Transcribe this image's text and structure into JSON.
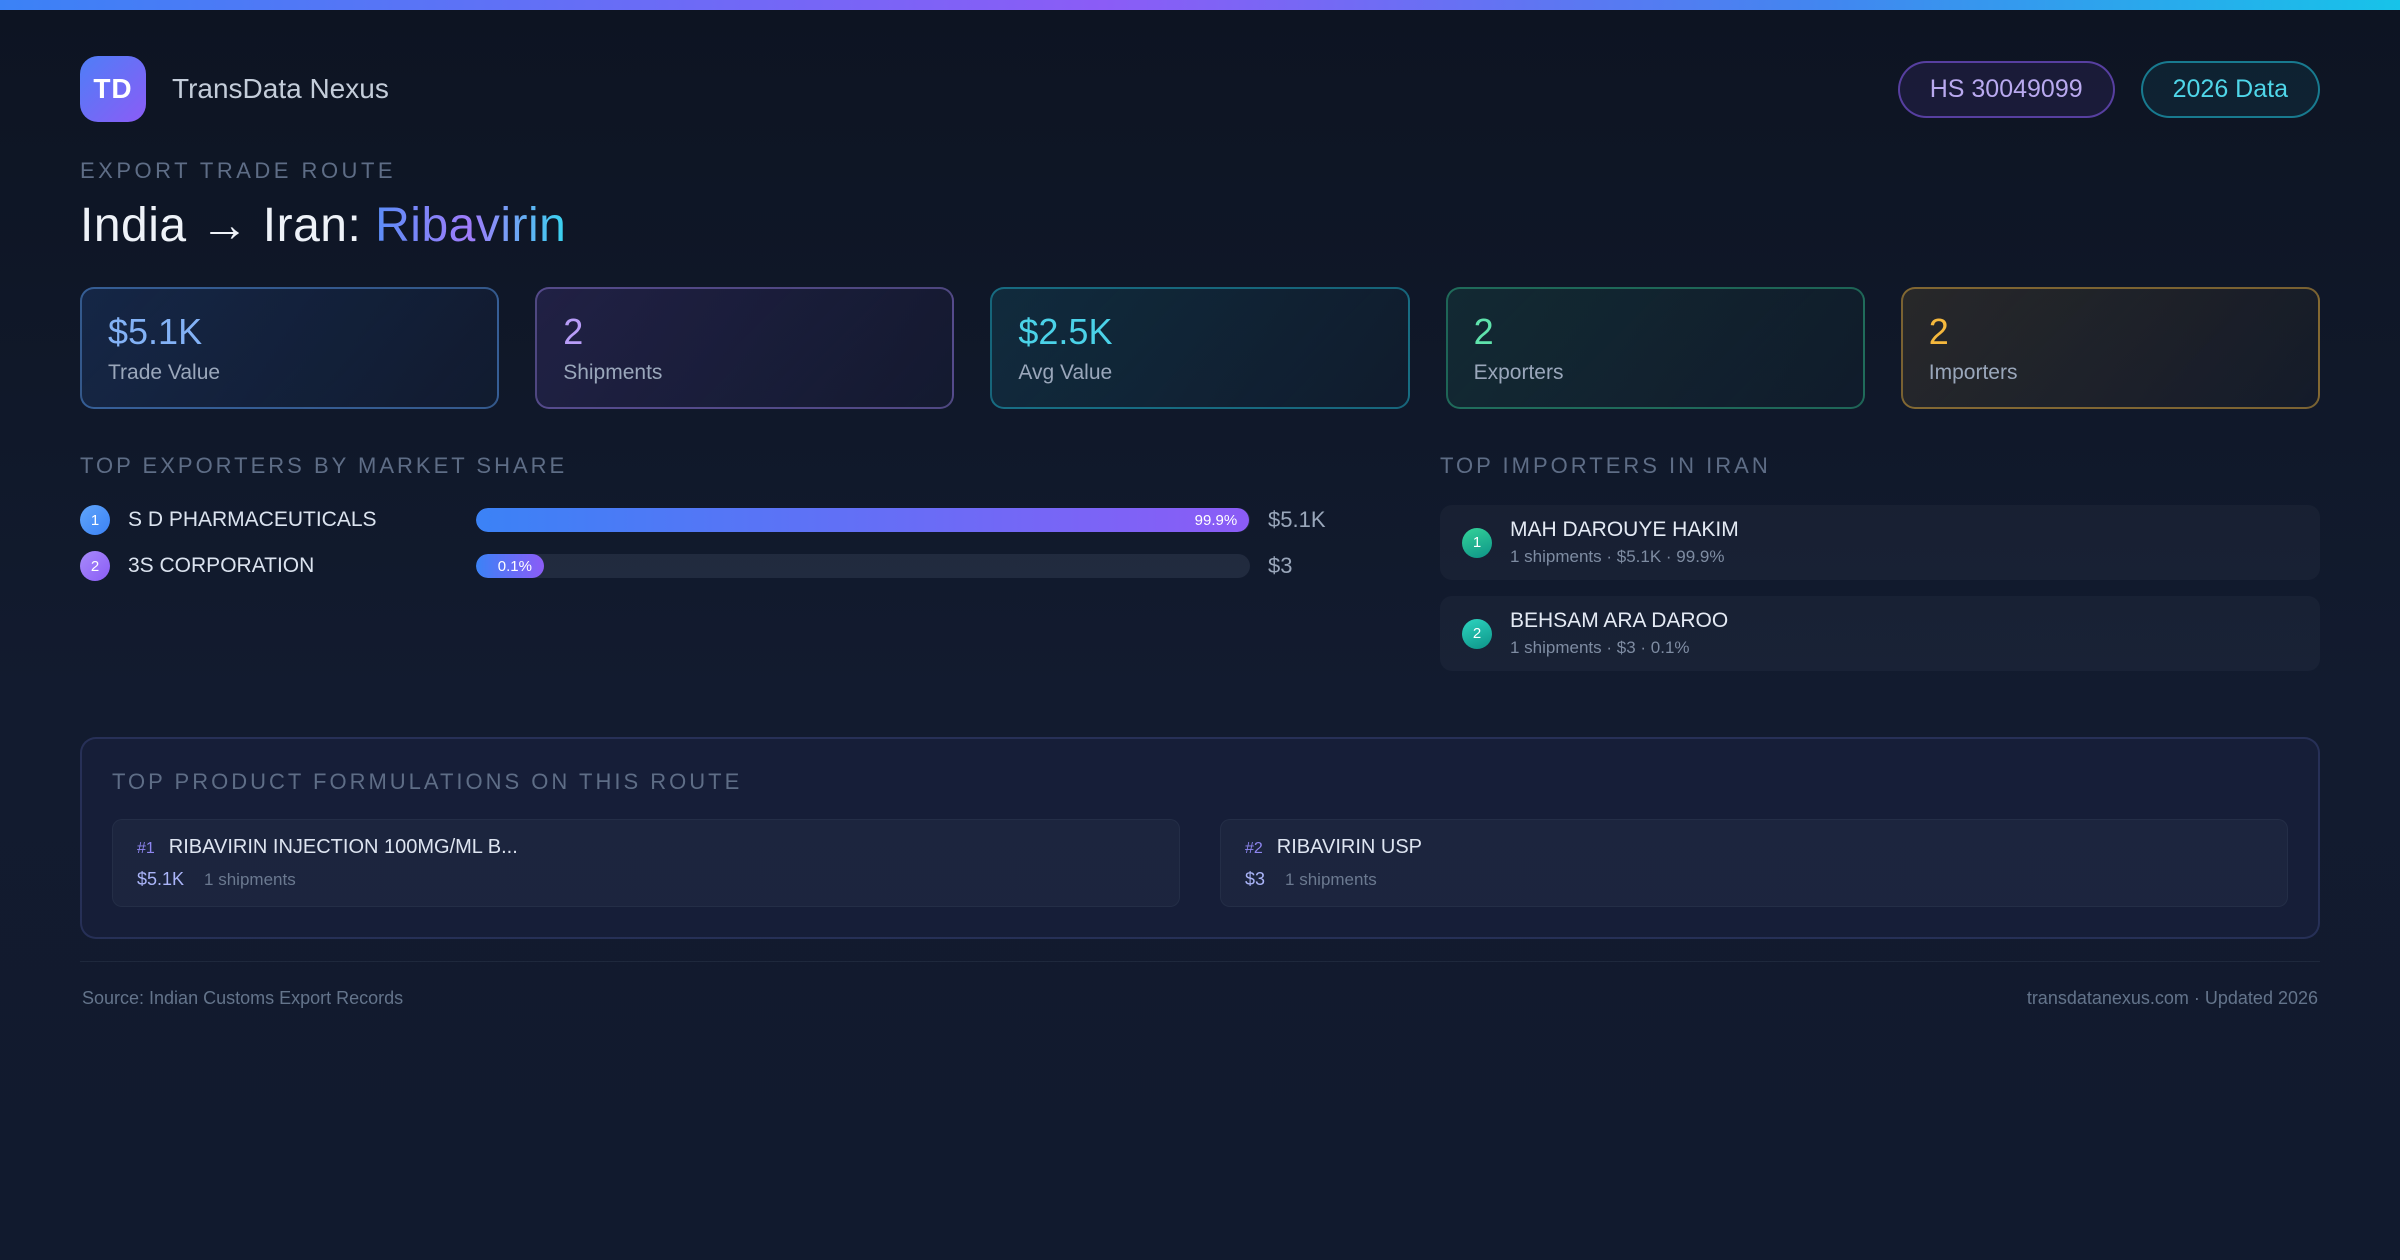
{
  "brand": {
    "logo": "TD",
    "name": "TransData Nexus"
  },
  "header_badges": {
    "hs_code": "HS 30049099",
    "year": "2026 Data"
  },
  "hero": {
    "eyebrow": "EXPORT TRADE ROUTE",
    "route": "India → Iran: ",
    "product": "Ribavirin"
  },
  "stats": [
    {
      "value": "$5.1K",
      "label": "Trade Value",
      "accent": "#83b2f6"
    },
    {
      "value": "2",
      "label": "Shipments",
      "accent": "#b89df8"
    },
    {
      "value": "$2.5K",
      "label": "Avg Value",
      "accent": "#4bd2e8"
    },
    {
      "value": "2",
      "label": "Exporters",
      "accent": "#5fe3ac"
    },
    {
      "value": "2",
      "label": "Importers",
      "accent": "#f5b83d"
    }
  ],
  "exporters": {
    "heading": "TOP EXPORTERS BY MARKET SHARE",
    "rows": [
      {
        "rank": "1",
        "name": "S D PHARMACEUTICALS",
        "share_pct": 99.9,
        "share_label": "99.9%",
        "value": "$5.1K"
      },
      {
        "rank": "2",
        "name": "3S CORPORATION",
        "share_pct": 0.1,
        "share_label": "0.1%",
        "value": "$3"
      }
    ]
  },
  "importers": {
    "heading": "TOP IMPORTERS IN IRAN",
    "rows": [
      {
        "rank": "1",
        "name": "MAH DAROUYE HAKIM",
        "meta": "1 shipments · $5.1K · 99.9%"
      },
      {
        "rank": "2",
        "name": "BEHSAM ARA DAROO",
        "meta": "1 shipments · $3 · 0.1%"
      }
    ]
  },
  "products": {
    "heading": "TOP PRODUCT FORMULATIONS ON THIS ROUTE",
    "items": [
      {
        "rank": "#1",
        "name": "RIBAVIRIN INJECTION 100MG/ML B...",
        "value": "$5.1K",
        "shipments": "1 shipments"
      },
      {
        "rank": "#2",
        "name": "RIBAVIRIN USP",
        "value": "$3",
        "shipments": "1 shipments"
      }
    ]
  },
  "footer": {
    "source": "Source: Indian Customs Export Records",
    "site": "transdatanexus.com · Updated 2026"
  }
}
